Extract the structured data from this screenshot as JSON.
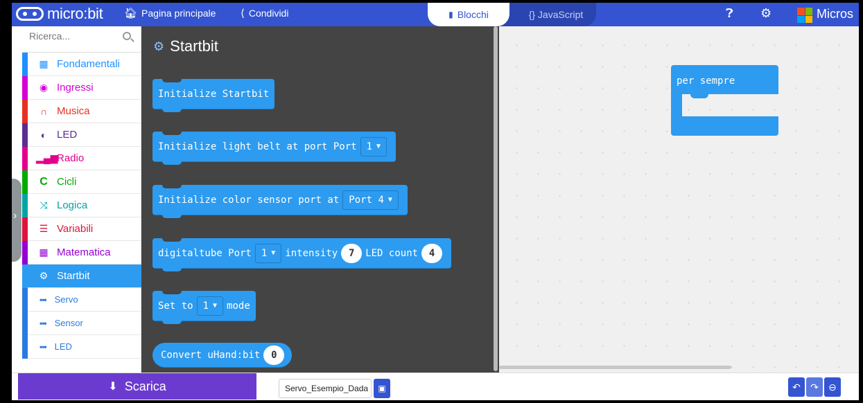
{
  "header": {
    "logo_text": "micro:bit",
    "home_label": "Pagina principale",
    "share_label": "Condividi",
    "blocks_label": "Blocchi",
    "js_label": "{} JavaScript",
    "ms_text": "Micros"
  },
  "sidebar": {
    "search_placeholder": "Ricerca...",
    "categories": [
      {
        "label": "Fondamentali",
        "color": "#1e90ff",
        "icon": "grid-icon"
      },
      {
        "label": "Ingressi",
        "color": "#d400d4",
        "icon": "target-icon"
      },
      {
        "label": "Musica",
        "color": "#e63022",
        "icon": "headphones-icon"
      },
      {
        "label": "LED",
        "color": "#5c2d91",
        "icon": "toggle-icon"
      },
      {
        "label": "Radio",
        "color": "#e3008c",
        "icon": "signal-icon"
      },
      {
        "label": "Cicli",
        "color": "#00aa00",
        "icon": "loop-icon"
      },
      {
        "label": "Logica",
        "color": "#00a4a6",
        "icon": "shuffle-icon"
      },
      {
        "label": "Variabili",
        "color": "#dc143c",
        "icon": "lines-icon"
      },
      {
        "label": "Matematica",
        "color": "#9400d3",
        "icon": "calculator-icon"
      }
    ],
    "active_category": "Startbit",
    "subcategories": [
      "Servo",
      "Sensor",
      "LED"
    ]
  },
  "flyout": {
    "title": "Startbit",
    "blocks": [
      {
        "text": "Initialize Startbit"
      },
      {
        "text": "Initialize light belt at port Port",
        "dropdown": "1"
      },
      {
        "text": "Initialize color sensor port at",
        "dropdown": "Port 4"
      },
      {
        "text": "digitaltube Port",
        "dropdown": "1",
        "text2": "intensity",
        "num1": "7",
        "text3": "LED count",
        "num2": "4"
      },
      {
        "text": "Set to",
        "dropdown": "1",
        "text2": "mode"
      },
      {
        "text": "Convert uHand:bit",
        "num1": "0"
      }
    ]
  },
  "workspace": {
    "forever_label": "per sempre"
  },
  "footer": {
    "download_label": "Scarica",
    "project_name": "Servo_Esempio_Dada"
  },
  "colors": {
    "header": "#3454d1",
    "block": "#2d9bf0",
    "flyout_bg": "#444444",
    "download": "#6b3bcf"
  }
}
